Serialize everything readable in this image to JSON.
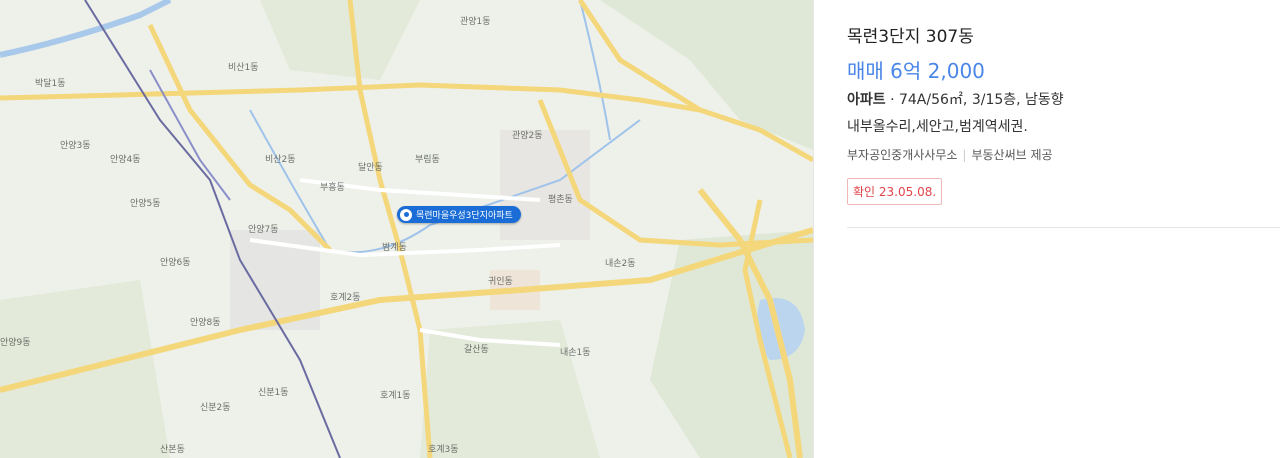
{
  "listing": {
    "name": "목련3단지 307동",
    "price": "매매 6억 2,000",
    "type": "아파트",
    "spec": " · 74A/56㎡, 3/15층, 남동향",
    "description": "내부올수리,세안고,범계역세권.",
    "agency": "부자공인중개사사무소",
    "provider": "부동산써브 제공",
    "confirm_date": "확인 23.05.08."
  },
  "map": {
    "marker_label": "목련마을우성3단지아파트",
    "labels": [
      "관양1동",
      "비산1동",
      "박달1동",
      "안양3동",
      "안양4동",
      "비산2동",
      "달안동",
      "부흥동",
      "부림동",
      "관양2동",
      "안양5동",
      "안양7동",
      "범계동",
      "평촌동",
      "귀인동",
      "안양6동",
      "호계2동",
      "안양8동",
      "안양9동",
      "내손2동",
      "내손1동",
      "갈산동",
      "신분1동",
      "신분2동",
      "호계1동",
      "호계3동",
      "산본동"
    ]
  }
}
